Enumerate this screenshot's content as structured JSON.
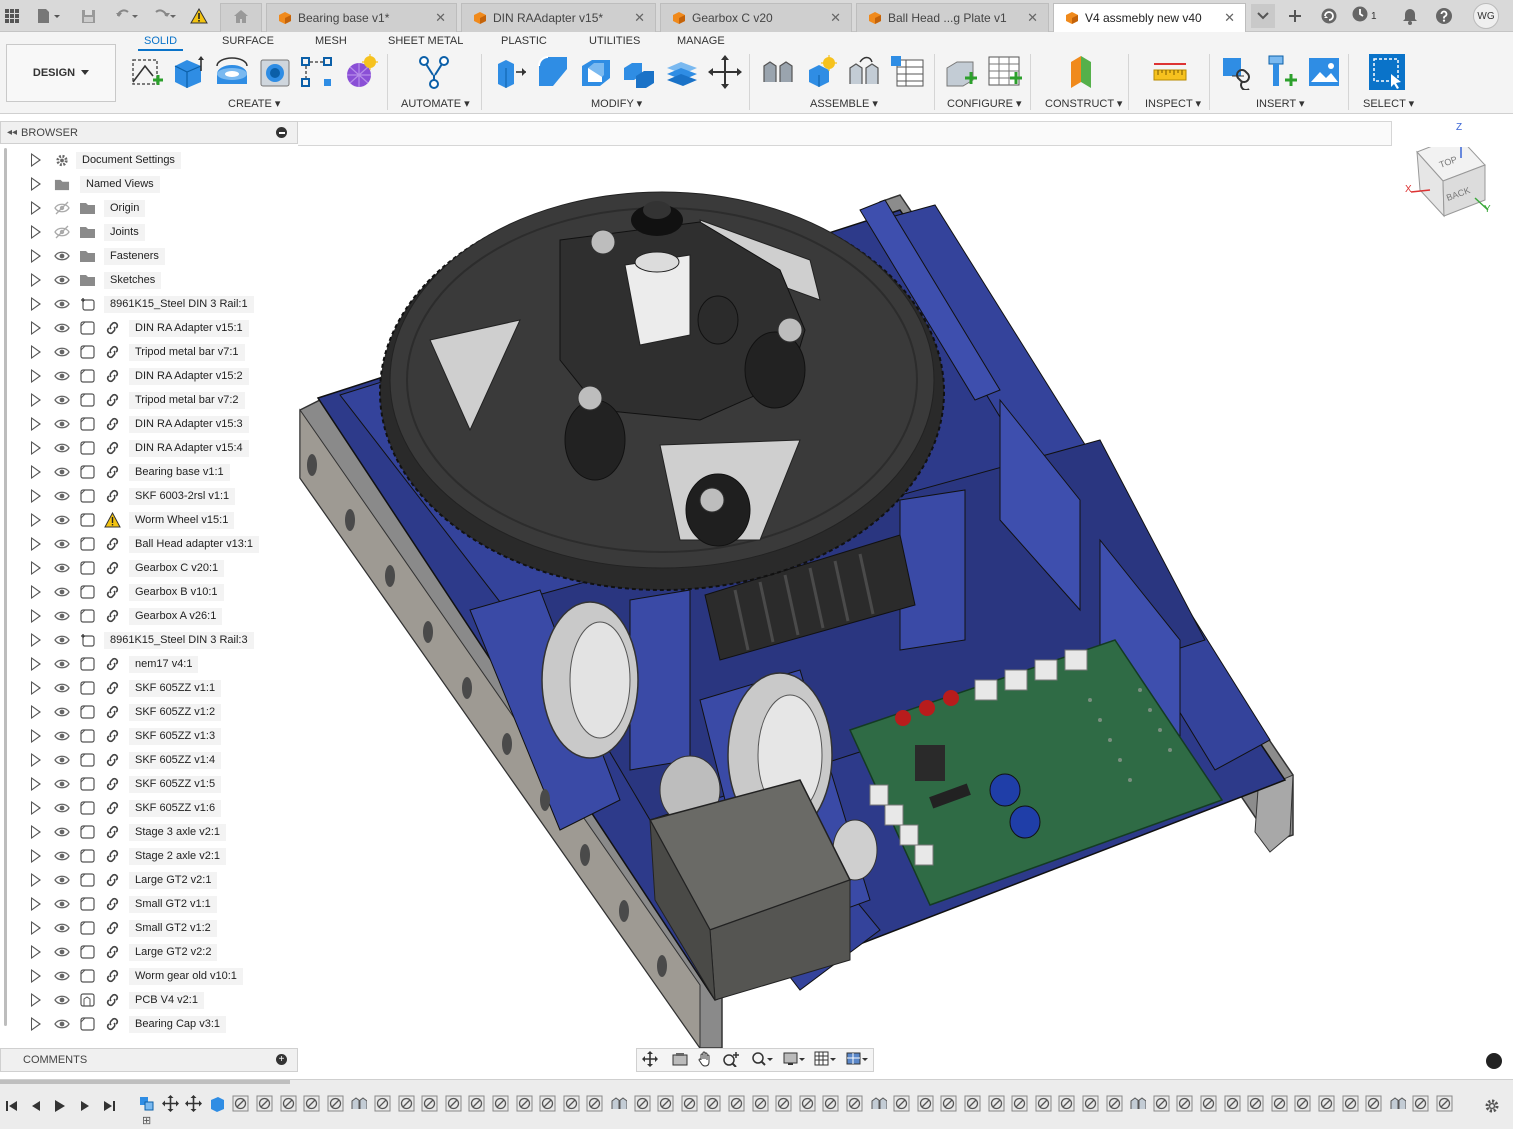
{
  "titlebar": {
    "tabs": [
      {
        "label": "Bearing base v1*",
        "active": false
      },
      {
        "label": "DIN RAAdapter v15*",
        "active": false
      },
      {
        "label": "Gearbox C v20",
        "active": false
      },
      {
        "label": "Ball Head ...g Plate v1",
        "active": false
      },
      {
        "label": "V4 assmebly new v40",
        "active": true
      }
    ],
    "job_count": "1",
    "user_initials": "WG"
  },
  "ribbon": {
    "workspace": "DESIGN",
    "tabs": [
      "SOLID",
      "SURFACE",
      "MESH",
      "SHEET METAL",
      "PLASTIC",
      "UTILITIES",
      "MANAGE"
    ],
    "active_tab": "SOLID",
    "groups": [
      "CREATE",
      "AUTOMATE",
      "MODIFY",
      "ASSEMBLE",
      "CONFIGURE",
      "CONSTRUCT",
      "INSPECT",
      "INSERT",
      "SELECT"
    ]
  },
  "browser": {
    "title": "BROWSER",
    "items": [
      {
        "label": "Document Settings",
        "kind": "settings"
      },
      {
        "label": "Named Views",
        "kind": "folder"
      },
      {
        "label": "Origin",
        "kind": "folder",
        "hidden": true
      },
      {
        "label": "Joints",
        "kind": "folder",
        "hidden": true
      },
      {
        "label": "Fasteners",
        "kind": "folder"
      },
      {
        "label": "Sketches",
        "kind": "folder"
      },
      {
        "label": "8961K15_Steel DIN 3 Rail:1",
        "kind": "anchored"
      },
      {
        "label": "DIN RA Adapter v15:1",
        "kind": "linked"
      },
      {
        "label": "Tripod metal bar v7:1",
        "kind": "linked"
      },
      {
        "label": "DIN RA Adapter v15:2",
        "kind": "linked"
      },
      {
        "label": "Tripod metal bar v7:2",
        "kind": "linked"
      },
      {
        "label": "DIN RA Adapter v15:3",
        "kind": "linked"
      },
      {
        "label": "DIN RA Adapter v15:4",
        "kind": "linked"
      },
      {
        "label": "Bearing base v1:1",
        "kind": "linked"
      },
      {
        "label": "SKF 6003-2rsl v1:1",
        "kind": "linked"
      },
      {
        "label": "Worm Wheel v15:1",
        "kind": "warning"
      },
      {
        "label": "Ball Head adapter v13:1",
        "kind": "linked"
      },
      {
        "label": "Gearbox C v20:1",
        "kind": "linked"
      },
      {
        "label": "Gearbox B v10:1",
        "kind": "linked"
      },
      {
        "label": "Gearbox A v26:1",
        "kind": "linked"
      },
      {
        "label": "8961K15_Steel DIN 3 Rail:3",
        "kind": "anchored"
      },
      {
        "label": "nem17 v4:1",
        "kind": "linked"
      },
      {
        "label": "SKF 605ZZ v1:1",
        "kind": "linked"
      },
      {
        "label": "SKF 605ZZ v1:2",
        "kind": "linked"
      },
      {
        "label": "SKF 605ZZ v1:3",
        "kind": "linked"
      },
      {
        "label": "SKF 605ZZ v1:4",
        "kind": "linked"
      },
      {
        "label": "SKF 605ZZ v1:5",
        "kind": "linked"
      },
      {
        "label": "SKF 605ZZ v1:6",
        "kind": "linked"
      },
      {
        "label": "Stage 3 axle v2:1",
        "kind": "linked"
      },
      {
        "label": "Stage 2 axle v2:1",
        "kind": "linked"
      },
      {
        "label": "Large GT2 v2:1",
        "kind": "linked"
      },
      {
        "label": "Small GT2 v1:1",
        "kind": "linked"
      },
      {
        "label": "Small GT2 v1:2",
        "kind": "linked"
      },
      {
        "label": "Large GT2 v2:2",
        "kind": "linked"
      },
      {
        "label": "Worm gear old v10:1",
        "kind": "linked"
      },
      {
        "label": "PCB V4 v2:1",
        "kind": "pcb"
      },
      {
        "label": "Bearing Cap v3:1",
        "kind": "linked"
      }
    ]
  },
  "viewcube": {
    "top": "TOP",
    "back": "BACK",
    "axis_x": "X",
    "axis_y": "Y",
    "axis_z": "Z"
  },
  "comments": {
    "title": "COMMENTS"
  },
  "colors": {
    "accent": "#0a73c9",
    "frame": "#2d3a8a",
    "gear": "#3a3a3a",
    "pcb": "#2f6b45"
  }
}
